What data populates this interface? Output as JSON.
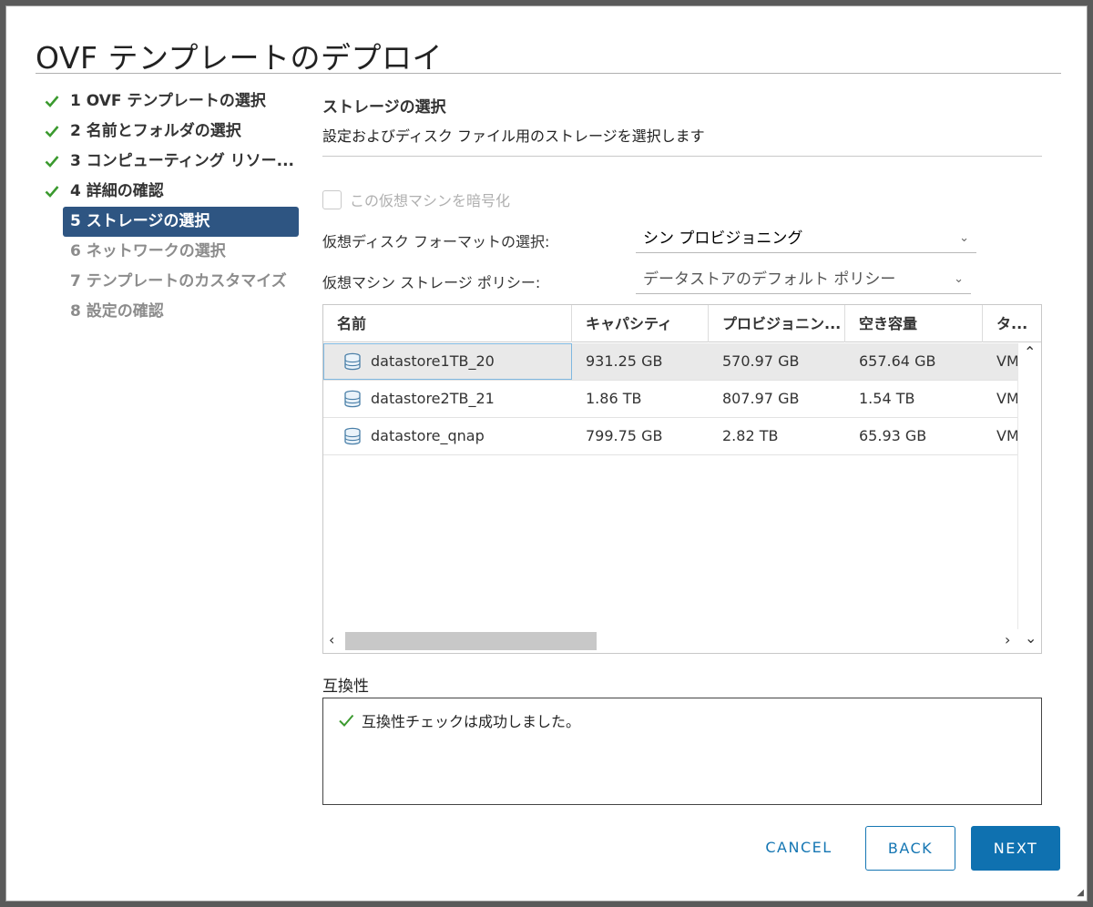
{
  "dialog": {
    "title": "OVF テンプレートのデプロイ"
  },
  "steps": [
    {
      "label": "1 OVF テンプレートの選択",
      "state": "done"
    },
    {
      "label": "2 名前とフォルダの選択",
      "state": "done"
    },
    {
      "label": "3 コンピューティング リソー...",
      "state": "done"
    },
    {
      "label": "4 詳細の確認",
      "state": "done"
    },
    {
      "label": "5 ストレージの選択",
      "state": "current"
    },
    {
      "label": "6 ネットワークの選択",
      "state": "disabled"
    },
    {
      "label": "7 テンプレートのカスタマイズ",
      "state": "disabled"
    },
    {
      "label": "8 設定の確認",
      "state": "disabled"
    }
  ],
  "section": {
    "title": "ストレージの選択",
    "description": "設定およびディスク ファイル用のストレージを選択します"
  },
  "encrypt": {
    "label": "この仮想マシンを暗号化",
    "checked": false,
    "enabled": false
  },
  "disk_format": {
    "label": "仮想ディスク フォーマットの選択:",
    "value": "シン プロビジョニング"
  },
  "storage_policy": {
    "label": "仮想マシン ストレージ ポリシー:",
    "value": "データストアのデフォルト ポリシー"
  },
  "table": {
    "columns": [
      "名前",
      "キャパシティ",
      "プロビジョニン...",
      "空き容量",
      "タ..."
    ],
    "rows": [
      {
        "name": "datastore1TB_20",
        "capacity": "931.25 GB",
        "provisioned": "570.97 GB",
        "free": "657.64 GB",
        "type": "VM",
        "selected": true
      },
      {
        "name": "datastore2TB_21",
        "capacity": "1.86 TB",
        "provisioned": "807.97 GB",
        "free": "1.54 TB",
        "type": "VM",
        "selected": false
      },
      {
        "name": "datastore_qnap",
        "capacity": "799.75 GB",
        "provisioned": "2.82 TB",
        "free": "65.93 GB",
        "type": "VM",
        "selected": false
      }
    ]
  },
  "compatibility": {
    "label": "互換性",
    "message": "互換性チェックは成功しました。"
  },
  "buttons": {
    "cancel": "CANCEL",
    "back": "BACK",
    "next": "NEXT"
  },
  "colors": {
    "accent": "#0f71b0",
    "current_step": "#2e5582",
    "check": "#3b9a2f"
  }
}
